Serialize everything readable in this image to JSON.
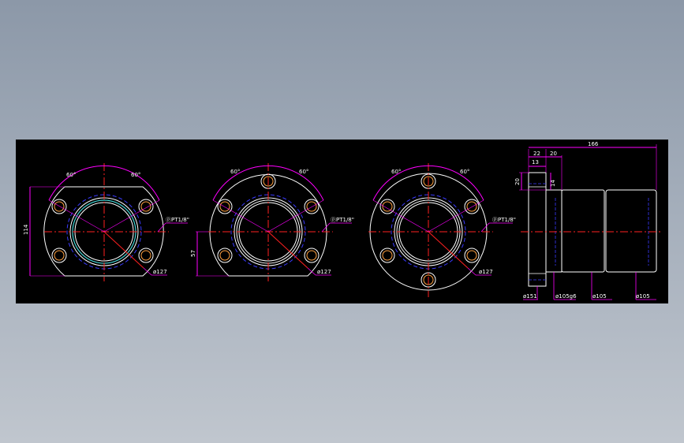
{
  "colors": {
    "background": "#000000",
    "outline": "#ffffff",
    "center_line": "#ff2020",
    "hidden_line": "#3a3aff",
    "dimension": "#ff00ff",
    "bolt_hole": "#ffa040",
    "bore_ring": "#40d0d0",
    "text": "#ffffff"
  },
  "views": [
    {
      "angle_left": "60°",
      "angle_right": "60°",
      "pipe_thread": "ⓟPT1/8\"",
      "bolt_circle": "ø127",
      "height_dim": "114"
    },
    {
      "angle_left": "60°",
      "angle_right": "60°",
      "pipe_thread": "ⓟPT1/8\"",
      "bolt_circle": "ø127",
      "height_dim": "57"
    },
    {
      "angle_left": "60°",
      "angle_right": "60°",
      "pipe_thread": "ⓟPT1/8\"",
      "bolt_circle": "ø127"
    }
  ],
  "side_view": {
    "overall_length": "166",
    "flange_offset": "22",
    "flange_thickness": "20",
    "step_13": "13",
    "height_20": "20",
    "depth_14": "14",
    "flange_diameter": "ø151",
    "pilot_diameter": "ø105g6",
    "body_diameter_1": "ø105",
    "body_diameter_2": "ø105"
  }
}
